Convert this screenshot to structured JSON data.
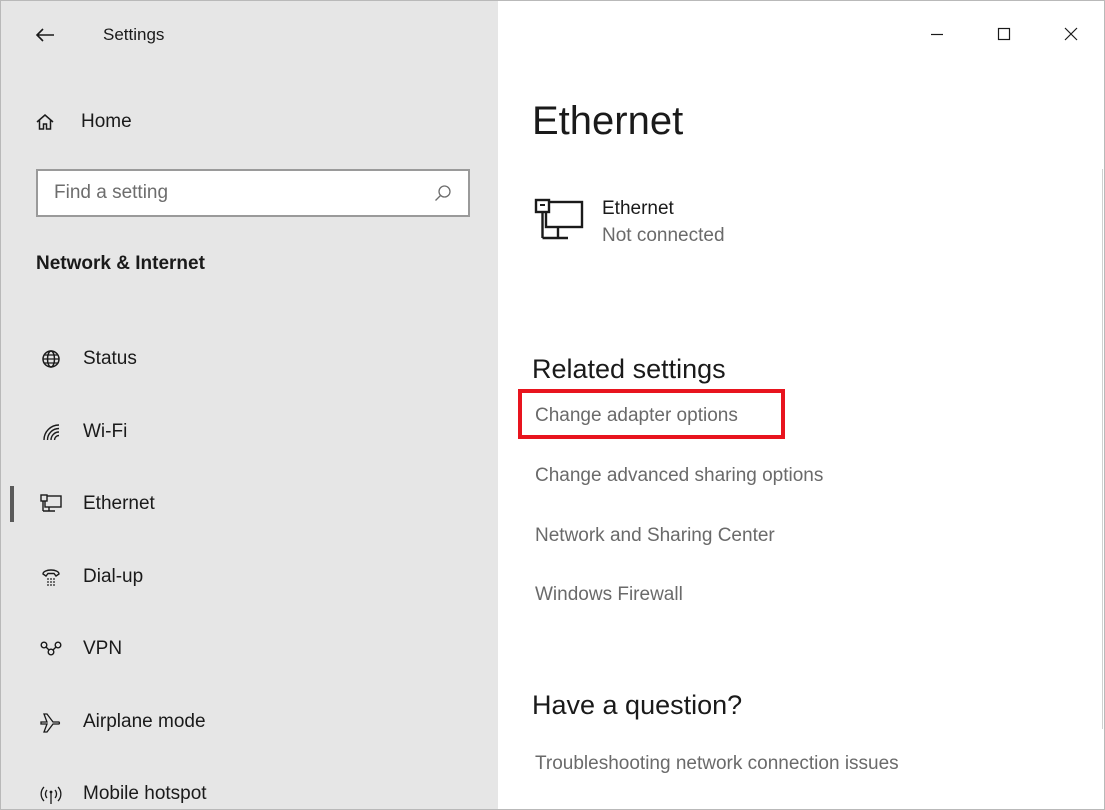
{
  "window": {
    "app_title": "Settings",
    "controls": {
      "minimize_icon": "minimize-icon",
      "maximize_icon": "maximize-icon",
      "close_icon": "close-icon"
    }
  },
  "sidebar": {
    "home_label": "Home",
    "search": {
      "placeholder": "Find a setting",
      "value": ""
    },
    "section_title": "Network & Internet",
    "items": [
      {
        "label": "Status",
        "icon": "globe-icon",
        "selected": false
      },
      {
        "label": "Wi-Fi",
        "icon": "wifi-icon",
        "selected": false
      },
      {
        "label": "Ethernet",
        "icon": "ethernet-icon",
        "selected": true
      },
      {
        "label": "Dial-up",
        "icon": "dialup-icon",
        "selected": false
      },
      {
        "label": "VPN",
        "icon": "vpn-icon",
        "selected": false
      },
      {
        "label": "Airplane mode",
        "icon": "airplane-icon",
        "selected": false
      },
      {
        "label": "Mobile hotspot",
        "icon": "hotspot-icon",
        "selected": false
      }
    ]
  },
  "main": {
    "title": "Ethernet",
    "connection": {
      "name": "Ethernet",
      "status": "Not connected"
    },
    "related_settings": {
      "title": "Related settings",
      "links": [
        "Change adapter options",
        "Change advanced sharing options",
        "Network and Sharing Center",
        "Windows Firewall"
      ]
    },
    "question": {
      "title": "Have a question?",
      "links": [
        "Troubleshooting network connection issues"
      ]
    }
  },
  "colors": {
    "sidebar_bg": "#e6e6e6",
    "highlight": "#e8141e",
    "link_text": "#6a6a6a"
  }
}
